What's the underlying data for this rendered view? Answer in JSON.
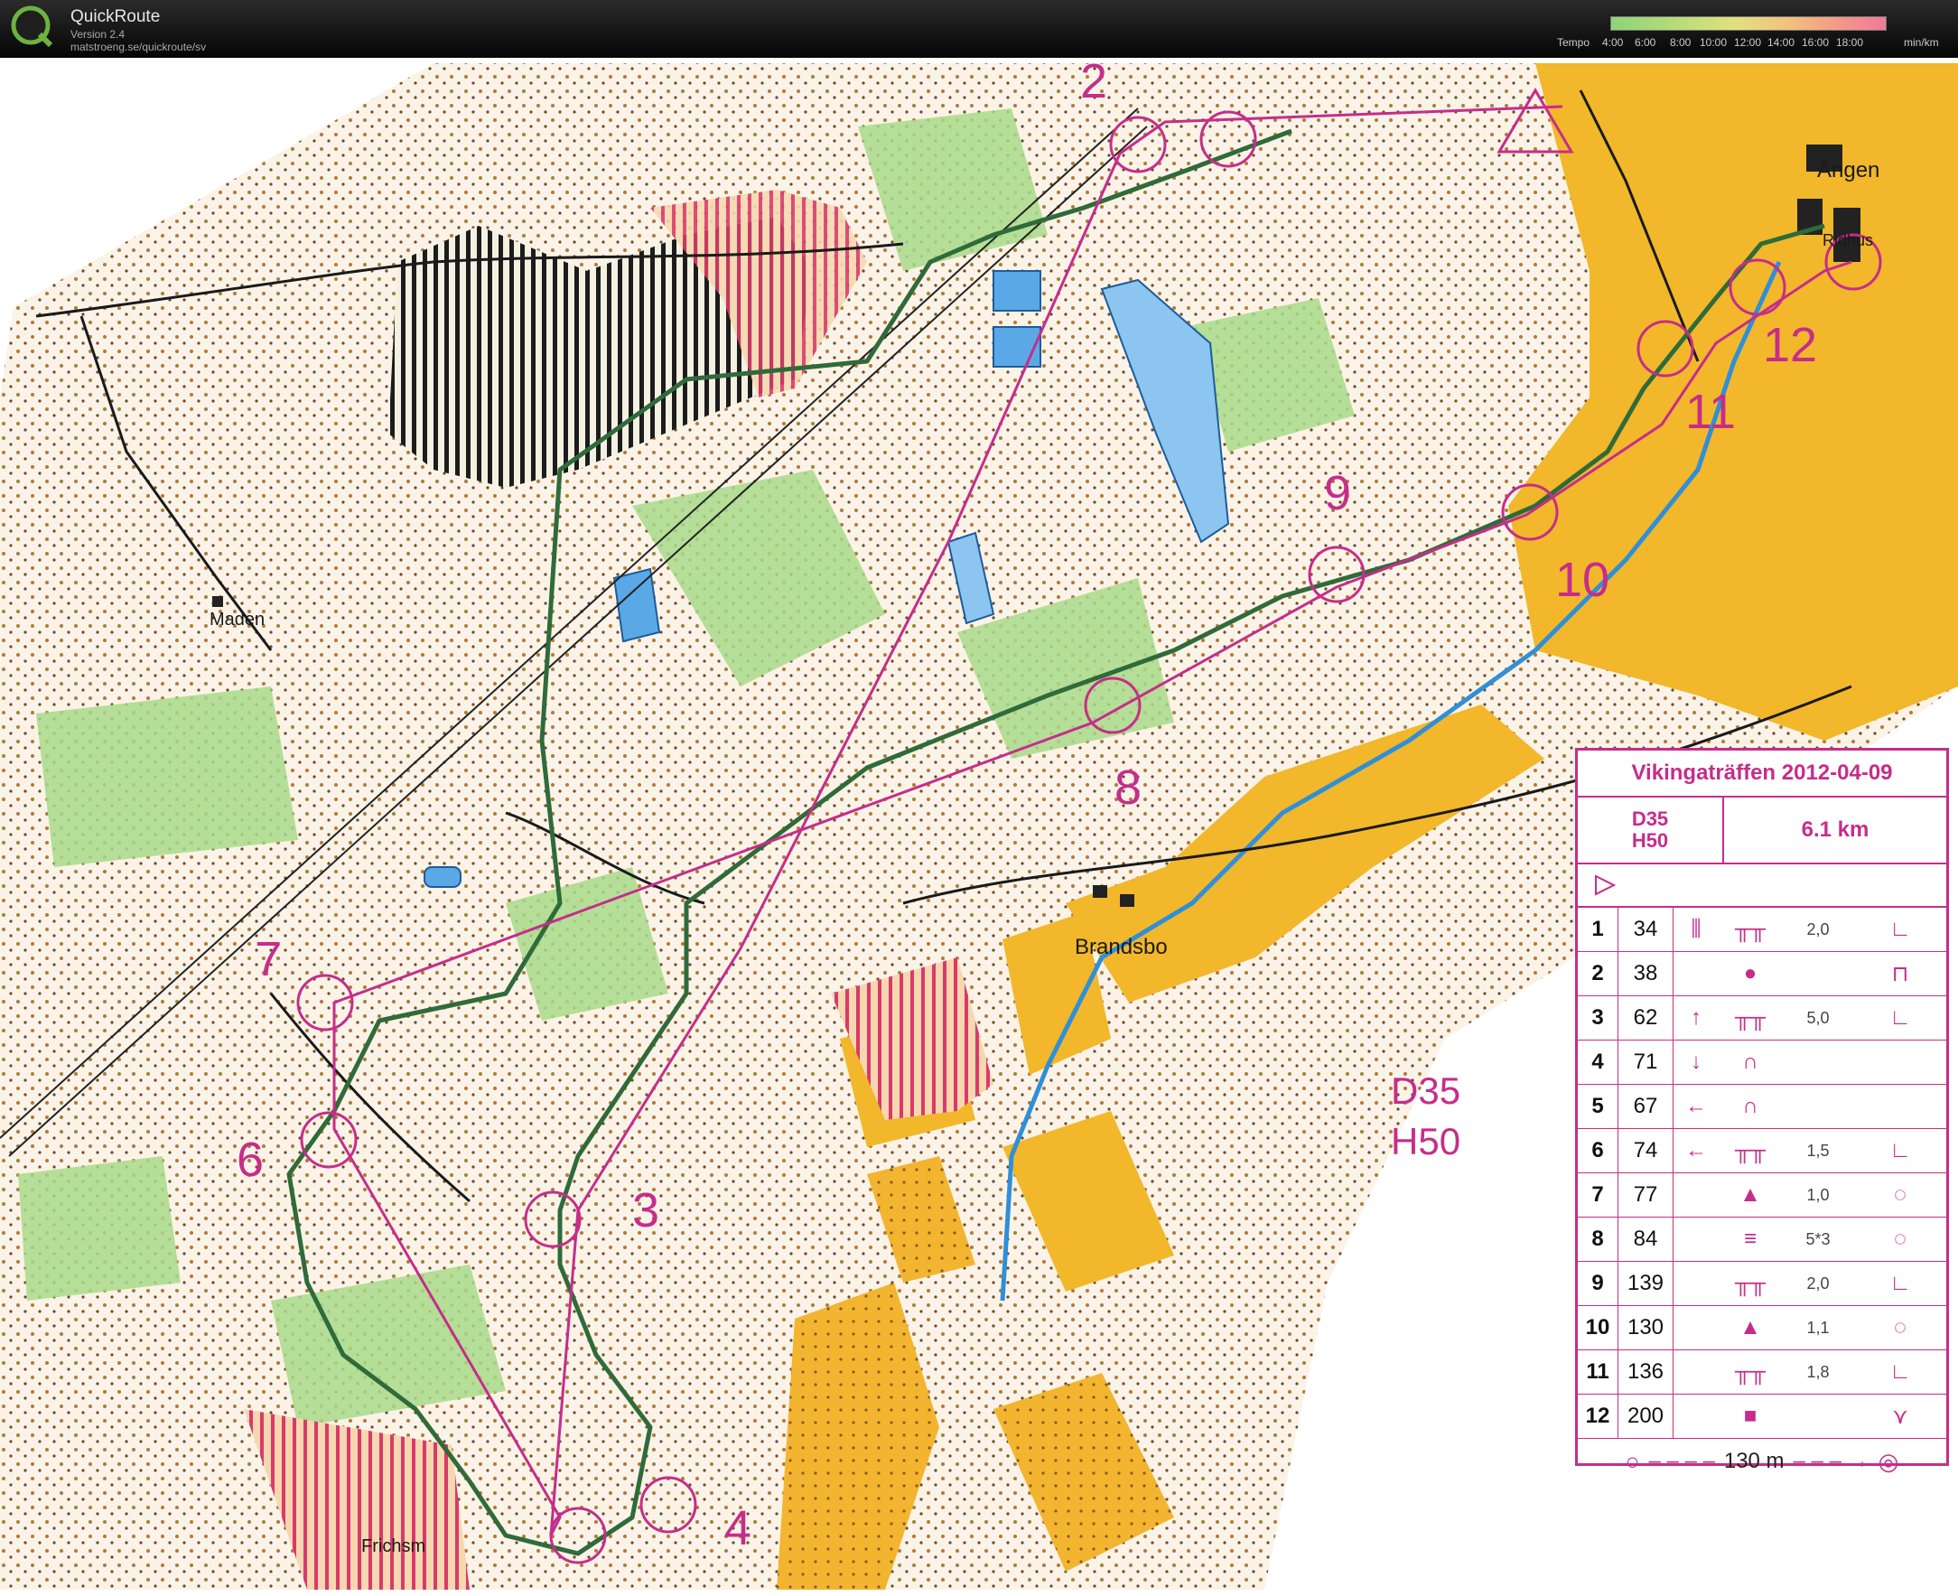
{
  "app": {
    "title": "QuickRoute",
    "version": "Version 2.4",
    "url": "matstroeng.se/quickroute/sv"
  },
  "tempo_legend": {
    "label": "Tempo",
    "ticks": [
      "4:00",
      "6:00",
      "8:00",
      "10:00",
      "12:00",
      "14:00",
      "16:00",
      "18:00"
    ],
    "unit": "min/km"
  },
  "map": {
    "place_names": [
      "Ängen",
      "Ridhus",
      "Maden",
      "Brandsbo",
      "Frichsm"
    ],
    "control_numbers": [
      "2",
      "3",
      "4",
      "6",
      "7",
      "8",
      "9",
      "10",
      "11",
      "12"
    ],
    "class_labels": [
      "D35",
      "H50"
    ],
    "colors": {
      "course": "#c62d8a",
      "route": "#2f6b3a",
      "field": "#f2b72a",
      "forest_green": "#9fd27c",
      "water": "#3b8fd9"
    }
  },
  "description_sheet": {
    "event": "Vikingaträffen 2012-04-09",
    "classes": [
      "D35",
      "H50"
    ],
    "length": "6.1 km",
    "controls": [
      {
        "no": "1",
        "code": "34",
        "dim": "2,0"
      },
      {
        "no": "2",
        "code": "38",
        "dim": ""
      },
      {
        "no": "3",
        "code": "62",
        "dim": "5,0"
      },
      {
        "no": "4",
        "code": "71",
        "dim": ""
      },
      {
        "no": "5",
        "code": "67",
        "dim": ""
      },
      {
        "no": "6",
        "code": "74",
        "dim": "1,5"
      },
      {
        "no": "7",
        "code": "77",
        "dim": "1,0"
      },
      {
        "no": "8",
        "code": "84",
        "dim": "5*3"
      },
      {
        "no": "9",
        "code": "139",
        "dim": "2,0"
      },
      {
        "no": "10",
        "code": "130",
        "dim": "1,1"
      },
      {
        "no": "11",
        "code": "136",
        "dim": "1,8"
      },
      {
        "no": "12",
        "code": "200",
        "dim": ""
      }
    ],
    "finish_distance": "130 m"
  }
}
